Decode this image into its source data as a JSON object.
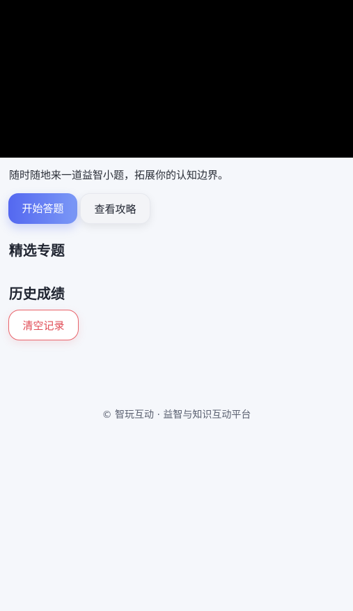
{
  "hero": {
    "tagline": "随时随地来一道益智小题，拓展你的认知边界。",
    "start_label": "开始答题",
    "guide_label": "查看攻略"
  },
  "sections": {
    "featured_title": "精选专题",
    "history_title": "历史成绩",
    "clear_label": "清空记录"
  },
  "footer": {
    "text": "© 智玩互动 · 益智与知识互动平台"
  },
  "colors": {
    "primary_start": "#5468f0",
    "primary_end": "#7b98f6",
    "danger": "#e04b55",
    "background": "#f5f7fb"
  }
}
